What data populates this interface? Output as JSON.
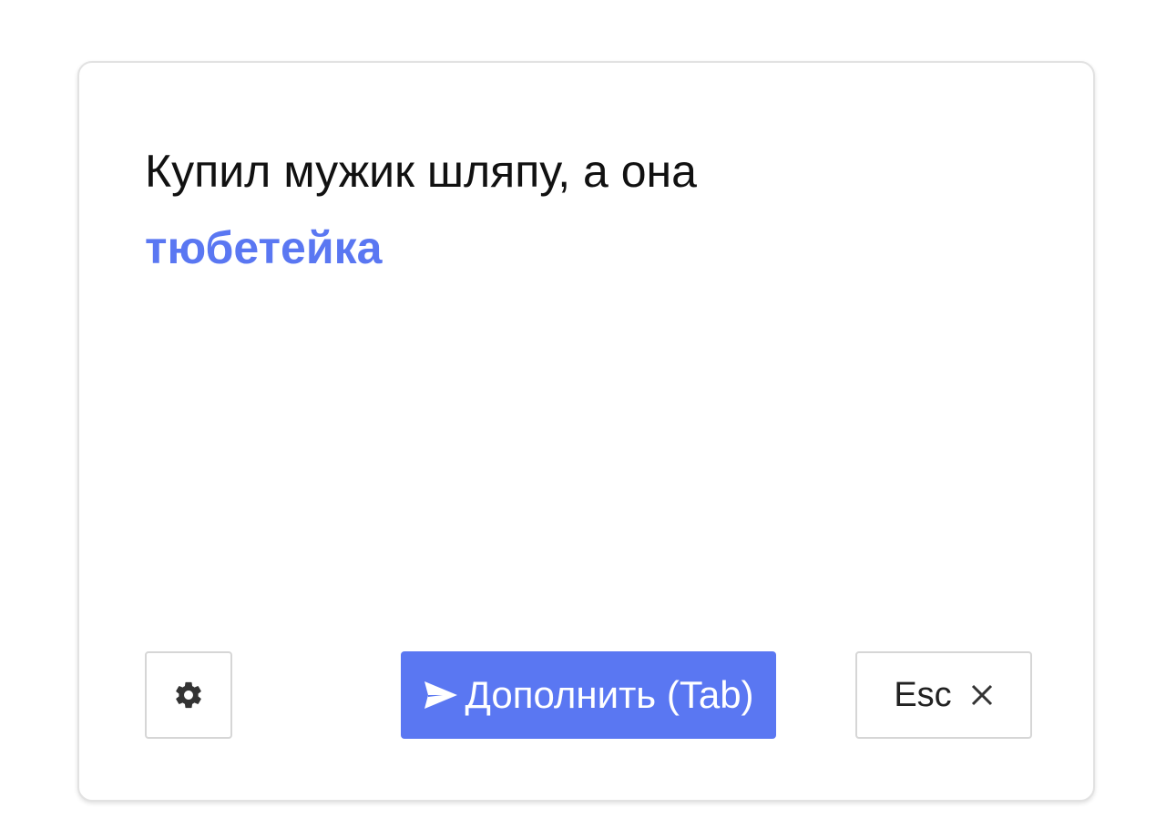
{
  "editor": {
    "prompt_text": "Купил мужик шляпу, а она",
    "completion_text": "тюбетейка"
  },
  "actions": {
    "settings_icon": "gear-icon",
    "complete_icon": "send-icon",
    "complete_label": "Дополнить (Tab)",
    "dismiss_label": "Esc",
    "dismiss_icon": "close-icon"
  },
  "colors": {
    "accent": "#5a77f2",
    "text": "#111111",
    "border": "#d6d6d6"
  }
}
